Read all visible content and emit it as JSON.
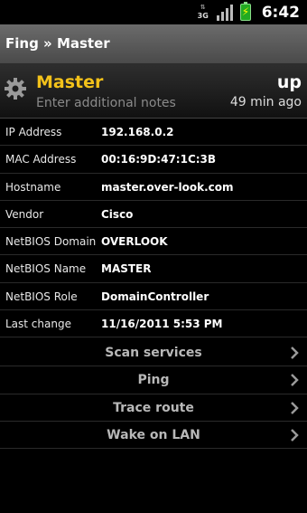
{
  "status_bar": {
    "network": "3G",
    "time": "6:42"
  },
  "app_bar": {
    "title": "Fing » Master"
  },
  "device": {
    "name": "Master",
    "notes_placeholder": "Enter additional notes",
    "state": "up",
    "age": "49 min ago"
  },
  "details": [
    {
      "label": "IP Address",
      "value": "192.168.0.2"
    },
    {
      "label": "MAC Address",
      "value": "00:16:9D:47:1C:3B"
    },
    {
      "label": "Hostname",
      "value": "master.over-look.com"
    },
    {
      "label": "Vendor",
      "value": "Cisco"
    },
    {
      "label": "NetBIOS Domain",
      "value": "OVERLOOK"
    },
    {
      "label": "NetBIOS Name",
      "value": "MASTER"
    },
    {
      "label": "NetBIOS Role",
      "value": "DomainController"
    },
    {
      "label": "Last change",
      "value": "11/16/2011 5:53 PM"
    }
  ],
  "actions": [
    {
      "label": "Scan services"
    },
    {
      "label": "Ping"
    },
    {
      "label": "Trace route"
    },
    {
      "label": "Wake on LAN"
    }
  ],
  "colors": {
    "accent": "#f3c21a",
    "background": "#000000",
    "appbar": "#5a5a5a"
  },
  "icons": {
    "device_icon": "gear-icon",
    "action_icon": "chevron-right-icon"
  }
}
